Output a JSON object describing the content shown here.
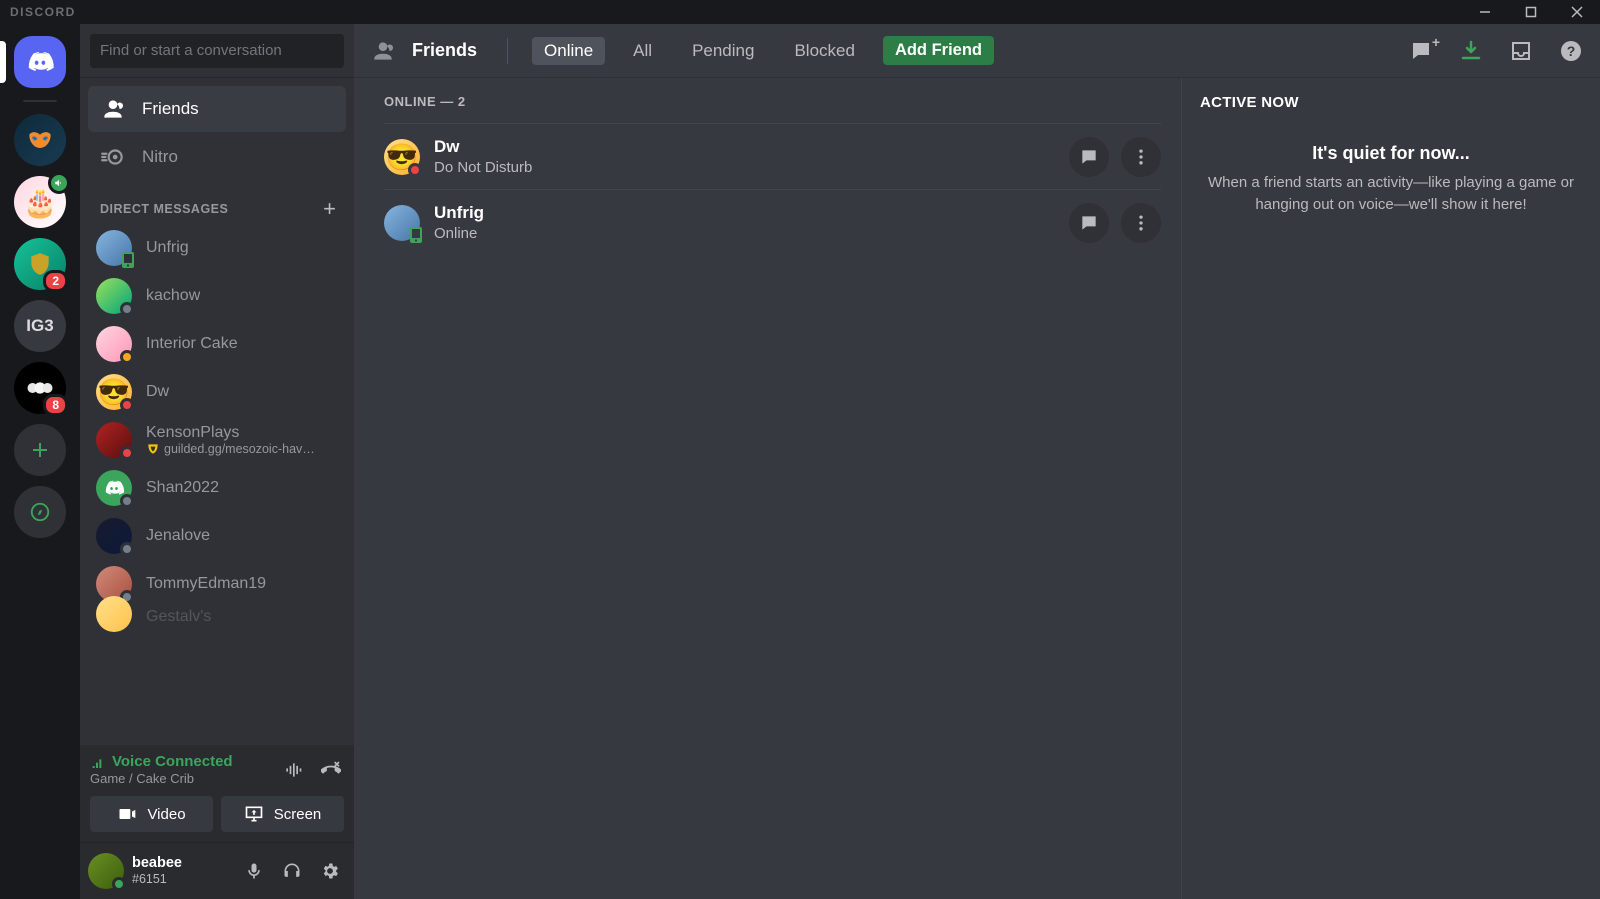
{
  "window": {
    "title": "DISCORD"
  },
  "servers": {
    "items": [
      {
        "name": "home",
        "type": "home",
        "selected": true
      },
      {
        "name": "server-mask",
        "type": "mask"
      },
      {
        "name": "server-cake",
        "type": "cake",
        "voice": true
      },
      {
        "name": "server-shield",
        "type": "shield",
        "badge": "2"
      },
      {
        "name": "server-ig3",
        "type": "text",
        "label": "IG3"
      },
      {
        "name": "server-moon",
        "type": "moon",
        "badge": "8"
      }
    ],
    "add_label": "+",
    "explore_label": "compass"
  },
  "sidebar": {
    "search_placeholder": "Find or start a conversation",
    "nav": {
      "friends_label": "Friends",
      "nitro_label": "Nitro"
    },
    "dm_header": "DIRECT MESSAGES",
    "dms": [
      {
        "name": "Unfrig",
        "status": "mobile-online",
        "avatar": "g1"
      },
      {
        "name": "kachow",
        "status": "offline",
        "avatar": "g2"
      },
      {
        "name": "Interior Cake",
        "status": "idle",
        "avatar": "g3"
      },
      {
        "name": "Dw",
        "status": "dnd",
        "avatar": "g4"
      },
      {
        "name": "KensonPlays",
        "status": "dnd",
        "avatar": "g5",
        "subtext": "guilded.gg/mesozoic-hav…",
        "sub_icon": "guilded"
      },
      {
        "name": "Shan2022",
        "status": "offline",
        "avatar": "g6"
      },
      {
        "name": "Jenalove",
        "status": "offline",
        "avatar": "g7"
      },
      {
        "name": "TommyEdman19",
        "status": "offline",
        "avatar": "g8"
      },
      {
        "name": "Gestalv's",
        "status": "",
        "avatar": "g9",
        "partial": true
      }
    ]
  },
  "voice": {
    "status": "Voice Connected",
    "channel": "Game / Cake Crib",
    "video_label": "Video",
    "screen_label": "Screen"
  },
  "user": {
    "name": "beabee",
    "tag": "#6151",
    "status": "online"
  },
  "topbar": {
    "friends_label": "Friends",
    "tabs": {
      "online": "Online",
      "all": "All",
      "pending": "Pending",
      "blocked": "Blocked"
    },
    "add_friend": "Add Friend"
  },
  "friends": {
    "header": "ONLINE — 2",
    "list": [
      {
        "name": "Dw",
        "status_text": "Do Not Disturb",
        "status": "dnd",
        "avatar": "g4"
      },
      {
        "name": "Unfrig",
        "status_text": "Online",
        "status": "mobile-online",
        "avatar": "g1"
      }
    ]
  },
  "active_now": {
    "header": "ACTIVE NOW",
    "title": "It's quiet for now...",
    "body": "When a friend starts an activity—like playing a game or hanging out on voice—we'll show it here!"
  }
}
